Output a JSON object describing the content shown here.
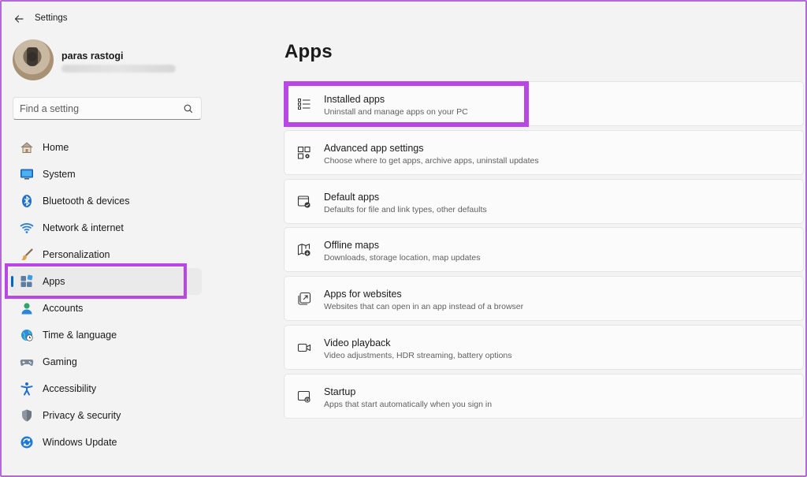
{
  "window": {
    "title": "Settings"
  },
  "profile": {
    "name": "paras rastogi"
  },
  "search": {
    "placeholder": "Find a setting"
  },
  "nav": {
    "items": [
      {
        "label": "Home"
      },
      {
        "label": "System"
      },
      {
        "label": "Bluetooth & devices"
      },
      {
        "label": "Network & internet"
      },
      {
        "label": "Personalization"
      },
      {
        "label": "Apps"
      },
      {
        "label": "Accounts"
      },
      {
        "label": "Time & language"
      },
      {
        "label": "Gaming"
      },
      {
        "label": "Accessibility"
      },
      {
        "label": "Privacy & security"
      },
      {
        "label": "Windows Update"
      }
    ],
    "selected": "Apps"
  },
  "main": {
    "title": "Apps",
    "cards": [
      {
        "title": "Installed apps",
        "subtitle": "Uninstall and manage apps on your PC",
        "icon": "list-icon"
      },
      {
        "title": "Advanced app settings",
        "subtitle": "Choose where to get apps, archive apps, uninstall updates",
        "icon": "app-settings-icon"
      },
      {
        "title": "Default apps",
        "subtitle": "Defaults for file and link types, other defaults",
        "icon": "default-apps-icon"
      },
      {
        "title": "Offline maps",
        "subtitle": "Downloads, storage location, map updates",
        "icon": "map-download-icon"
      },
      {
        "title": "Apps for websites",
        "subtitle": "Websites that can open in an app instead of a browser",
        "icon": "open-in-app-icon"
      },
      {
        "title": "Video playback",
        "subtitle": "Video adjustments, HDR streaming, battery options",
        "icon": "video-icon"
      },
      {
        "title": "Startup",
        "subtitle": "Apps that start automatically when you sign in",
        "icon": "startup-icon"
      }
    ]
  },
  "colors": {
    "accent": "#0067c0",
    "highlight": "#b847e6",
    "background": "#f3f3f3"
  }
}
